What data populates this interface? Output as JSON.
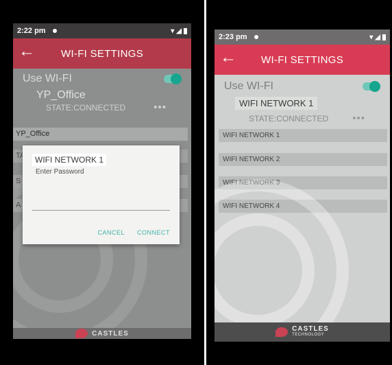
{
  "left": {
    "status": {
      "time": "2:22 pm"
    },
    "appbar": {
      "title": "WI-FI SETTINGS"
    },
    "use_wifi": {
      "label": "Use WI-FI"
    },
    "connected": {
      "ssid": "YP_Office",
      "state": "STATE:CONNECTED"
    },
    "field": {
      "value": "YP_Office"
    },
    "stubs": [
      "TA",
      "S",
      "A"
    ],
    "dialog": {
      "title": "WIFI NETWORK 1",
      "subtitle": "Enter Password",
      "cancel": "CANCEL",
      "connect": "CONNECT"
    },
    "footer": {
      "brand": "CASTLES"
    }
  },
  "right": {
    "status": {
      "time": "2:23 pm"
    },
    "appbar": {
      "title": "WI-FI SETTINGS"
    },
    "use_wifi": {
      "label": "Use WI-FI"
    },
    "connected": {
      "ssid": "WIFI NETWORK 1",
      "state": "STATE:CONNECTED"
    },
    "networks": [
      "WIFI NETWORK 1",
      "WIFI NETWORK 2",
      "WIFI NETWORK 3",
      "WIFI NETWORK 4"
    ],
    "footer": {
      "brand": "CASTLES",
      "sub": "TECHNOLOGY"
    }
  },
  "colors": {
    "accent": "#d83c54",
    "toggle": "#16a58f",
    "action": "#3eb3a5"
  }
}
